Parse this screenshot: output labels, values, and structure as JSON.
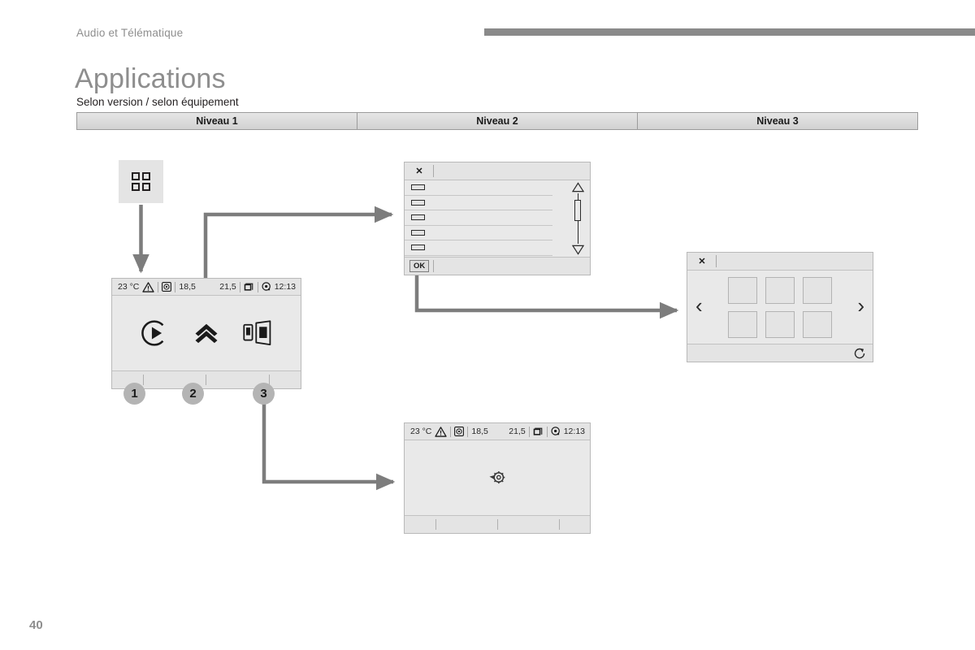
{
  "header": {
    "running_head": "Audio et Télématique",
    "title": "Applications",
    "subtitle": "Selon version / selon équipement"
  },
  "levels_table": {
    "columns": [
      "Niveau 1",
      "Niveau 2",
      "Niveau 3"
    ]
  },
  "apps_tile": {
    "icon": "apps-grid-icon"
  },
  "callouts": [
    {
      "number": "1"
    },
    {
      "number": "2"
    },
    {
      "number": "3"
    }
  ],
  "screen_home": {
    "status_bar": {
      "temperature": "23 °C",
      "warning_icon": "warning-triangle-icon",
      "target_icon": "target-icon",
      "left_temp": "18,5",
      "right_temp": "21,5",
      "media_icon": "media-stack-icon",
      "settings_icon": "settings-gear-icon",
      "time": "12:13"
    },
    "icons": [
      {
        "name": "play-circle-icon"
      },
      {
        "name": "double-chevron-up-icon"
      },
      {
        "name": "phone-mirror-icon"
      }
    ]
  },
  "screen_list": {
    "close_label": "✕",
    "ok_label": "OK",
    "rows": [
      {
        "icon": "list-item-icon"
      },
      {
        "icon": "list-item-icon"
      },
      {
        "icon": "list-item-icon"
      },
      {
        "icon": "list-item-icon"
      },
      {
        "icon": "list-item-icon"
      }
    ],
    "scroll_up_icon": "triangle-up-icon",
    "scroll_down_icon": "triangle-down-icon"
  },
  "screen_grid": {
    "close_label": "✕",
    "prev_label": "‹",
    "next_label": "›",
    "refresh_icon": "refresh-icon",
    "cells": [
      {
        "index": "1"
      },
      {
        "index": "2"
      },
      {
        "index": "3"
      },
      {
        "index": "4"
      },
      {
        "index": "5"
      },
      {
        "index": "6"
      }
    ]
  },
  "screen_loading": {
    "status_bar": {
      "temperature": "23 °C",
      "warning_icon": "warning-triangle-icon",
      "target_icon": "target-icon",
      "left_temp": "18,5",
      "right_temp": "21,5",
      "media_icon": "media-stack-icon",
      "settings_icon": "settings-gear-icon",
      "time": "12:13"
    },
    "center_icon": "loading-gear-icon"
  },
  "footer": {
    "page_number": "40"
  },
  "colors": {
    "rule": "#8a8a8a",
    "title_gray": "#8e8e8e",
    "screen_bg": "#e9e9e9",
    "screen_bar": "#e4e4e4",
    "connector": "#7d7d7d",
    "callout": "#b4b4b4"
  }
}
